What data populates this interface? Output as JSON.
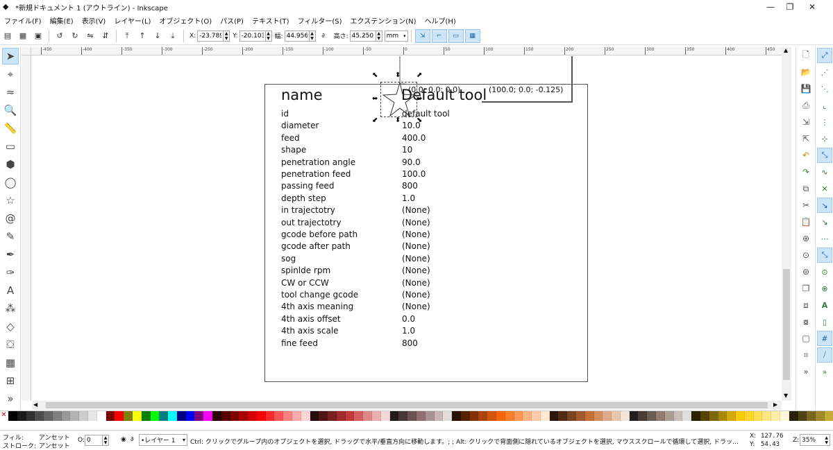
{
  "window": {
    "title": "*新規ドキュメント 1 (アウトライン) - Inkscape",
    "minimize": "—",
    "maximize": "❐",
    "close": "✕"
  },
  "menu": [
    "ファイル(F)",
    "編集(E)",
    "表示(V)",
    "レイヤー(L)",
    "オブジェクト(O)",
    "パス(P)",
    "テキスト(T)",
    "フィルター(S)",
    "エクステンション(N)",
    "ヘルプ(H)"
  ],
  "toolbar": {
    "x_label": "X:",
    "x_value": "-23.789",
    "y_label": "Y:",
    "y_value": "-20.103",
    "w_label": "幅:",
    "w_value": "44.956",
    "h_label": "高さ:",
    "h_value": "45.250",
    "unit": "mm"
  },
  "ruler": {
    "marks": [
      "-450",
      "-400",
      "-350",
      "-300",
      "-250",
      "-200",
      "-150",
      "-100",
      "-50",
      "0",
      "50",
      "100",
      "150",
      "200",
      "250",
      "300",
      "350",
      "400",
      "450"
    ]
  },
  "canvas": {
    "title_name": "name",
    "title_value": "Default tool",
    "coord_1": "(0.0; 0.0; 0.0)",
    "coord_2": "(100.0; 0.0; -0.125)",
    "rows": [
      {
        "label": "id",
        "value": "default tool"
      },
      {
        "label": "diameter",
        "value": "10.0"
      },
      {
        "label": "feed",
        "value": "400.0"
      },
      {
        "label": "shape",
        "value": "10"
      },
      {
        "label": "penetration angle",
        "value": "90.0"
      },
      {
        "label": "penetration feed",
        "value": "100.0"
      },
      {
        "label": "passing feed",
        "value": "800"
      },
      {
        "label": "depth step",
        "value": "1.0"
      },
      {
        "label": "in trajectotry",
        "value": "(None)"
      },
      {
        "label": "out trajectotry",
        "value": "(None)"
      },
      {
        "label": "gcode before path",
        "value": "(None)"
      },
      {
        "label": "gcode after path",
        "value": "(None)"
      },
      {
        "label": "sog",
        "value": "(None)"
      },
      {
        "label": "spinlde rpm",
        "value": "(None)"
      },
      {
        "label": "CW or CCW",
        "value": "(None)"
      },
      {
        "label": "tool change gcode",
        "value": "(None)"
      },
      {
        "label": "4th axis meaning",
        "value": "(None)"
      },
      {
        "label": "4th axis offset",
        "value": "0.0"
      },
      {
        "label": "4th axis scale",
        "value": "1.0"
      },
      {
        "label": "fine feed",
        "value": "800"
      }
    ]
  },
  "tools": [
    {
      "name": "selector-tool-icon",
      "glyph": "➤",
      "active": true
    },
    {
      "name": "node-tool-icon",
      "glyph": "⌖"
    },
    {
      "name": "tweak-tool-icon",
      "glyph": "≈"
    },
    {
      "name": "zoom-tool-icon",
      "glyph": "🔍"
    },
    {
      "name": "measure-tool-icon",
      "glyph": "📏"
    },
    {
      "name": "rectangle-tool-icon",
      "glyph": "▭"
    },
    {
      "name": "3d-box-tool-icon",
      "glyph": "⬢"
    },
    {
      "name": "ellipse-tool-icon",
      "glyph": "◯"
    },
    {
      "name": "star-tool-icon",
      "glyph": "☆"
    },
    {
      "name": "spiral-tool-icon",
      "glyph": "@"
    },
    {
      "name": "pencil-tool-icon",
      "glyph": "✎"
    },
    {
      "name": "pen-tool-icon",
      "glyph": "✒"
    },
    {
      "name": "calligraphy-tool-icon",
      "glyph": "✑"
    },
    {
      "name": "text-tool-icon",
      "glyph": "A"
    },
    {
      "name": "spray-tool-icon",
      "glyph": "⁂"
    },
    {
      "name": "eraser-tool-icon",
      "glyph": "◇"
    },
    {
      "name": "paint-bucket-tool-icon",
      "glyph": "⛋"
    },
    {
      "name": "gradient-tool-icon",
      "glyph": "▦"
    },
    {
      "name": "mesh-tool-icon",
      "glyph": "⊞"
    },
    {
      "name": "more-tools-icon",
      "glyph": "»"
    }
  ],
  "status": {
    "fill_label": "フィル:",
    "fill_value": "アンセット",
    "stroke_label": "ストローク:",
    "stroke_value": "アンセット",
    "opacity_label": "O:",
    "opacity_value": "0",
    "layer": "•レイヤー 1",
    "message": "Ctrl: クリックでグループ内のオブジェクトを選択, ドラッグで水平/垂直方向に移動します。; ; Alt: クリックで背面側に隠れているオブジェクトを選択, マウススクロールで循環して選択, ドラッグで選択オ...",
    "cursor_x_label": "X:",
    "cursor_x": "127.76",
    "cursor_y_label": "Y:",
    "cursor_y": "54.43",
    "zoom_label": "Z:",
    "zoom": "35%"
  },
  "colors": {
    "accent": "#cce4f7",
    "palette": [
      "#000000",
      "#1a1a1a",
      "#333333",
      "#4d4d4d",
      "#666666",
      "#808080",
      "#999999",
      "#b3b3b3",
      "#cccccc",
      "#e6e6e6",
      "#ffffff",
      "#800000",
      "#ff0000",
      "#808000",
      "#ffff00",
      "#008000",
      "#00ff00",
      "#008080",
      "#00ffff",
      "#000080",
      "#0000ff",
      "#800080",
      "#ff00ff",
      "#2b0000",
      "#550000",
      "#800000",
      "#aa0000",
      "#d40000",
      "#ff0000",
      "#ff2a2a",
      "#ff5555",
      "#ff8080",
      "#ffaaaa",
      "#ffd5d5",
      "#280b0b",
      "#501616",
      "#782121",
      "#a02c2c",
      "#c83737",
      "#d35f5f",
      "#de8787",
      "#e9afaf",
      "#f4d7d7",
      "#241c1c",
      "#483737",
      "#6c5353",
      "#916f6f",
      "#ac9393",
      "#c8b7b7",
      "#e3dbdb",
      "#2b1100",
      "#552200",
      "#803300",
      "#aa4400",
      "#d45500",
      "#ff6600",
      "#ff7f2a",
      "#ff9955",
      "#ffb380",
      "#ffccaa",
      "#ffe6d5",
      "#28170b",
      "#502d16",
      "#784421",
      "#a05a2c",
      "#c87137",
      "#d38d5f",
      "#deaa87",
      "#e9c6af",
      "#f4e3d7",
      "#241f1c",
      "#483e37",
      "#6c5d53",
      "#917c6f",
      "#ac9d93",
      "#c8beb7",
      "#e3dedb",
      "#2b2200",
      "#554400",
      "#806600",
      "#aa8800",
      "#d4aa00",
      "#ffcc00",
      "#ffd42a",
      "#ffdd55",
      "#ffe680",
      "#ffeeaa",
      "#fff6d5",
      "#28220b",
      "#504416",
      "#786721",
      "#a0892c",
      "#c8ab37"
    ]
  }
}
